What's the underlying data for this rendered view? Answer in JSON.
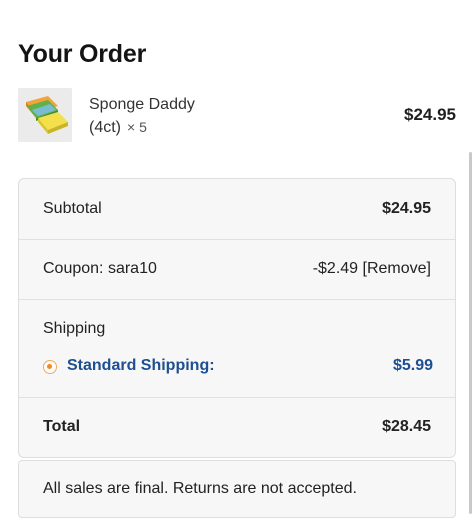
{
  "order": {
    "title": "Your Order"
  },
  "item": {
    "name": "Sponge Daddy",
    "variant": "(4ct)",
    "quantity": "× 5",
    "price": "$24.95",
    "image_icon": "sponge-thumbnail"
  },
  "summary": {
    "subtotal_label": "Subtotal",
    "subtotal_value": "$24.95",
    "coupon_label": "Coupon: sara10",
    "coupon_value": "-$2.49",
    "coupon_remove": "[Remove]",
    "shipping_label": "Shipping",
    "shipping_option_label": "Standard Shipping:",
    "shipping_option_price": "$5.99",
    "total_label": "Total",
    "total_value": "$28.45"
  },
  "notice": {
    "text": "All sales are final. Returns are not accepted."
  },
  "colors": {
    "shipping_accent": "#1d4f91",
    "radio_accent": "#f08a24",
    "card_background": "#f7f7f7"
  }
}
